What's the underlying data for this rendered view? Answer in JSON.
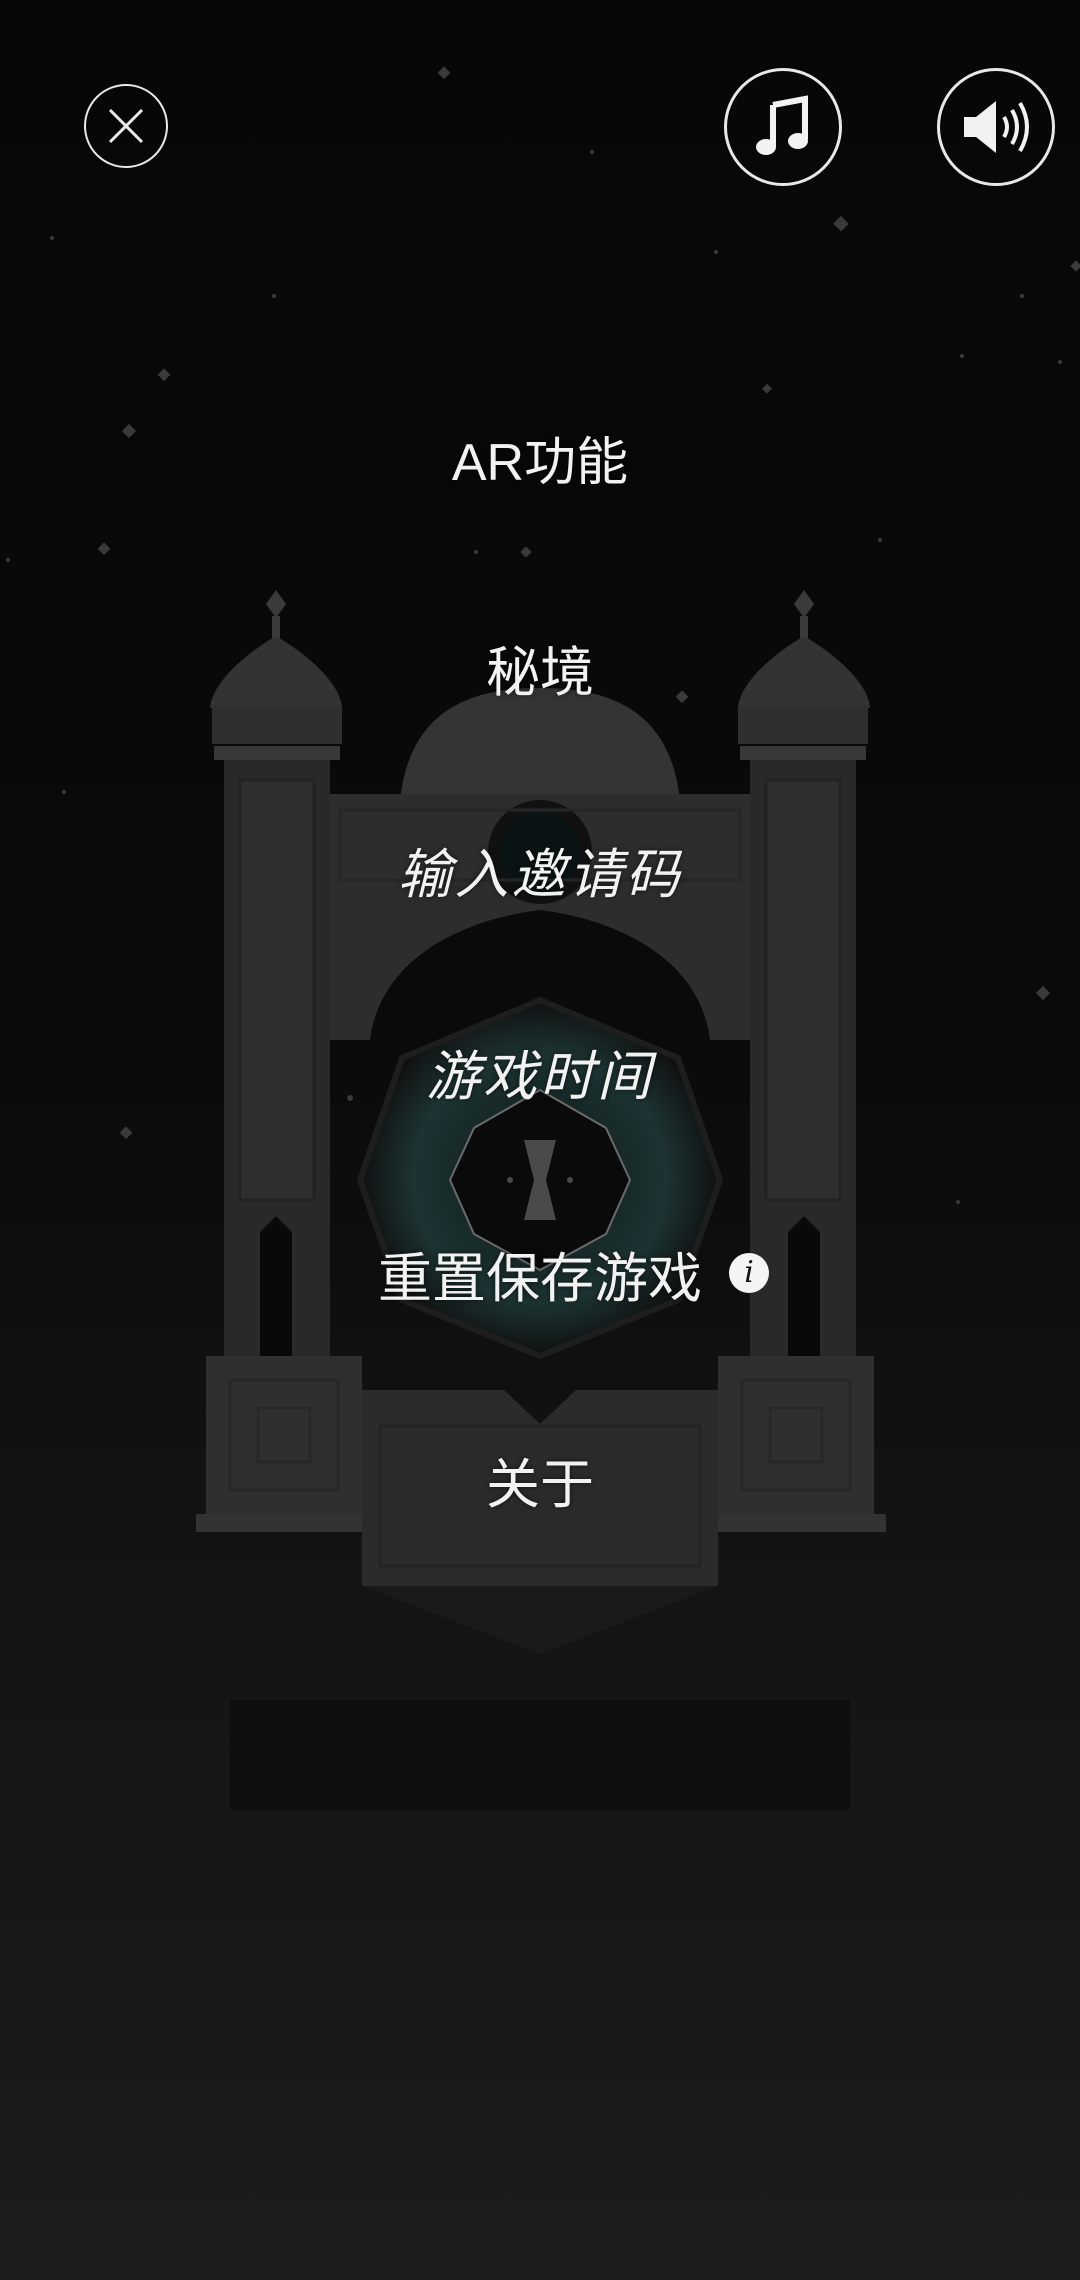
{
  "top_bar": {
    "close_icon": "close-circle-icon",
    "music_icon": "music-note-icon",
    "sound_icon": "speaker-volume-icon"
  },
  "menu": {
    "ar": "AR功能",
    "secret_realm": "秘境",
    "invite_code": "输入邀请码",
    "play_time": "游戏时间",
    "reset_save": "重置保存游戏",
    "reset_info_icon": "i",
    "about": "关于"
  },
  "colors": {
    "background": "#0a0a0a",
    "text": "#f2f2f2",
    "structure": "#2e2e2e",
    "structure_light": "#3a3a3a",
    "accent_crystal": "#2a4a4a"
  }
}
